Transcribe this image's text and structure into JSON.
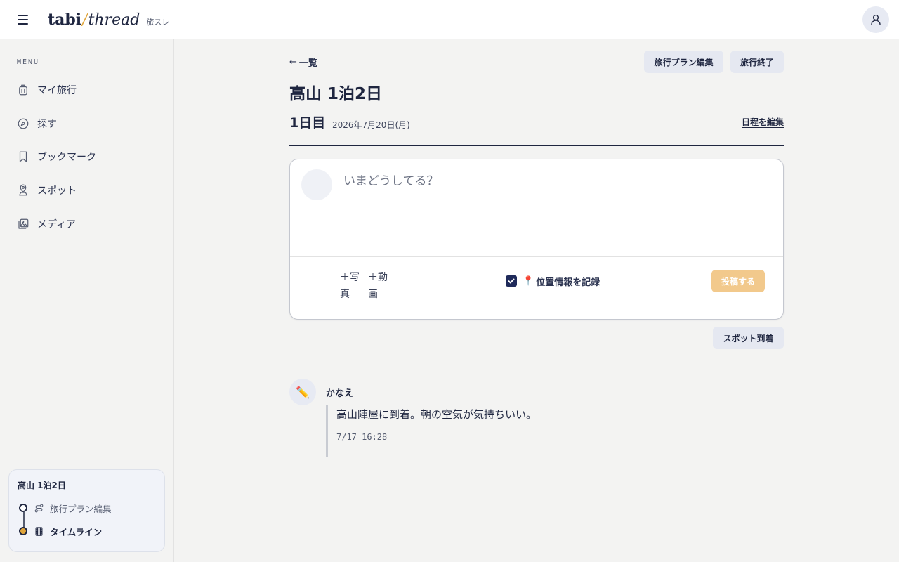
{
  "header": {
    "logo_main": "tabi",
    "logo_slash": "/",
    "logo_italic": "thread",
    "logo_sub": "旅スレ"
  },
  "sidebar": {
    "menu_heading": "MENU",
    "items": [
      {
        "label": "マイ旅行",
        "icon": "luggage-icon"
      },
      {
        "label": "探す",
        "icon": "compass-icon"
      },
      {
        "label": "ブックマーク",
        "icon": "bookmark-icon"
      },
      {
        "label": "スポット",
        "icon": "map-pin-icon"
      },
      {
        "label": "メディア",
        "icon": "gallery-icon"
      }
    ],
    "trip_card": {
      "title": "高山 1泊2日",
      "steps": [
        {
          "label": "旅行プラン編集",
          "icon": "route-icon",
          "active": false
        },
        {
          "label": "タイムライン",
          "icon": "film-icon",
          "active": true
        }
      ]
    }
  },
  "main": {
    "back": {
      "arrow": "←",
      "label": "一覧"
    },
    "edit_plan_button": "旅行プラン編集",
    "end_trip_button": "旅行終了",
    "trip_title": "高山 1泊2日",
    "day_title": "1日目",
    "day_date": "2026年7月20日(月)",
    "edit_schedule": "日程を編集",
    "composer": {
      "placeholder": "いまどうしてる？",
      "add_photo_line1": "＋写",
      "add_photo_line2": "真",
      "add_video_line1": "＋動",
      "add_video_line2": "画",
      "location_checked": true,
      "location_pin": "📍",
      "location_label": "位置情報を記録",
      "post_button": "投稿する"
    },
    "spot_arrival_button": "スポット到着",
    "posts": [
      {
        "avatar_emoji": "✏️",
        "author": "かなえ",
        "text": "高山陣屋に到着。朝の空気が気持ちいい。",
        "time": "7/17 16:28"
      }
    ]
  },
  "colors": {
    "navy": "#1f2640",
    "accent": "#e0a53a",
    "soft_button": "#e5e8f1",
    "post_button_disabled": "#f2c98c",
    "background": "#f3f3f2"
  }
}
